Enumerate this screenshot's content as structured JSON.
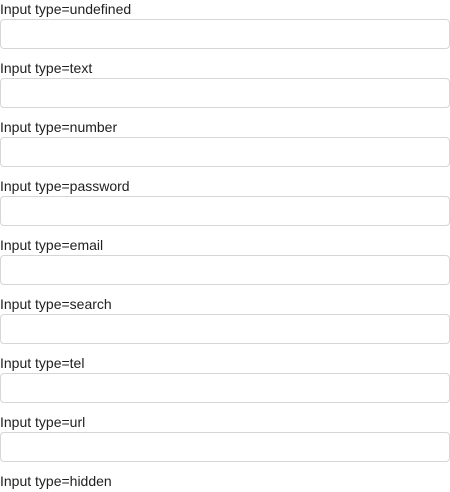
{
  "fields": [
    {
      "label": "Input type=undefined",
      "value": ""
    },
    {
      "label": "Input type=text",
      "value": ""
    },
    {
      "label": "Input type=number",
      "value": ""
    },
    {
      "label": "Input type=password",
      "value": ""
    },
    {
      "label": "Input type=email",
      "value": ""
    },
    {
      "label": "Input type=search",
      "value": ""
    },
    {
      "label": "Input type=tel",
      "value": ""
    },
    {
      "label": "Input type=url",
      "value": ""
    },
    {
      "label": "Input type=hidden",
      "value": ""
    }
  ]
}
